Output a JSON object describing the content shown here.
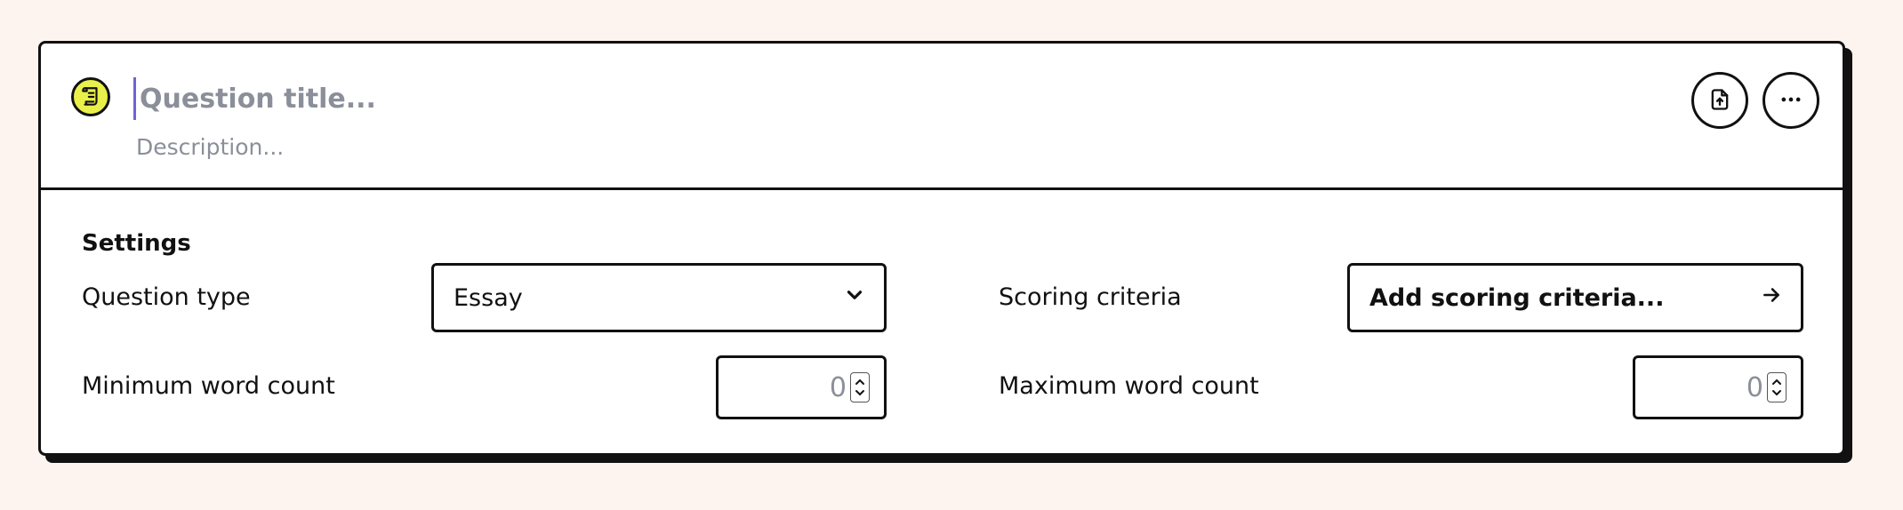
{
  "question": {
    "title_placeholder": "Question title...",
    "description_placeholder": "Description..."
  },
  "actions": {
    "export_icon": "file-upload-icon",
    "more_icon": "more-horizontal-icon"
  },
  "settings": {
    "heading": "Settings",
    "question_type_label": "Question type",
    "question_type_value": "Essay",
    "scoring_criteria_label": "Scoring criteria",
    "scoring_criteria_button": "Add scoring criteria...",
    "min_word_count_label": "Minimum word count",
    "min_word_count_value": "0",
    "max_word_count_label": "Maximum word count",
    "max_word_count_value": "0"
  },
  "colors": {
    "background": "#fdf4ef",
    "icon_badge": "#e9f04a",
    "caret": "#6d63d9",
    "placeholder": "#8a8f99"
  }
}
